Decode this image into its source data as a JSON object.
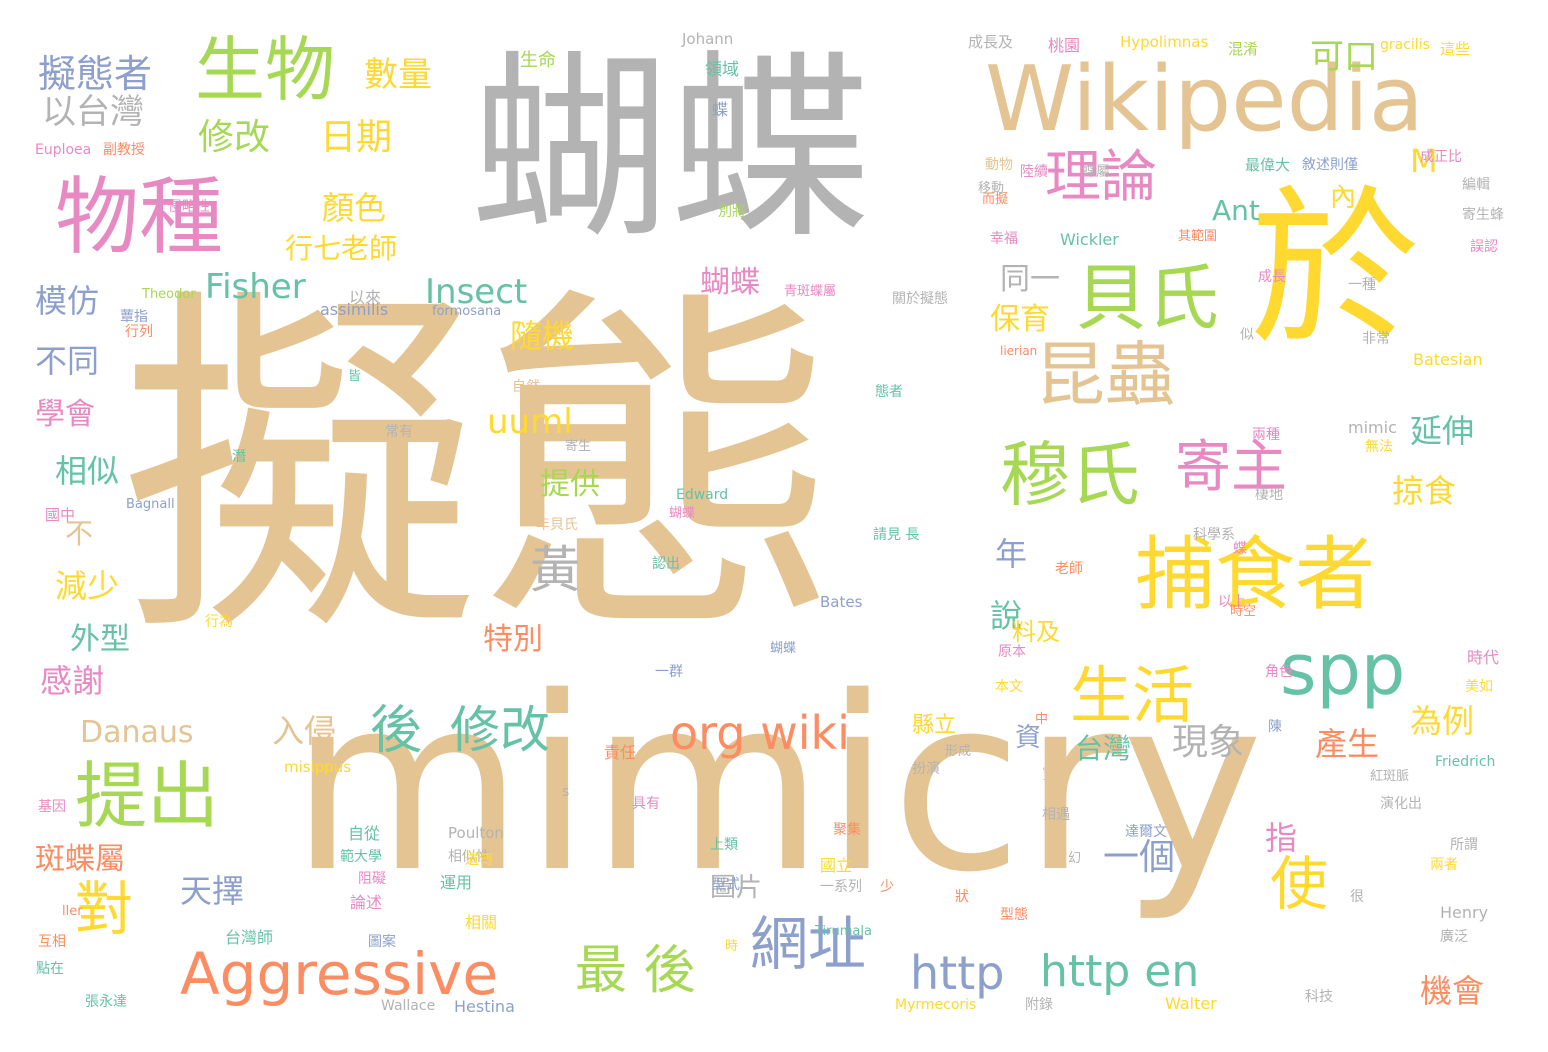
{
  "cloud": {
    "words": [
      {
        "text": "擬態",
        "color": "#e5c494"
      },
      {
        "text": "mimicry",
        "color": "#e5c494"
      },
      {
        "text": "蝴蝶",
        "color": "#b3b3b3"
      },
      {
        "text": "於",
        "color": "#ffd92f"
      },
      {
        "text": "Wikipedia",
        "color": "#e5c494"
      },
      {
        "text": "物種",
        "color": "#e78ac3"
      },
      {
        "text": "生物",
        "color": "#a6d854"
      },
      {
        "text": "捕食者",
        "color": "#ffd92f"
      },
      {
        "text": "提出",
        "color": "#a6d854"
      },
      {
        "text": "昆蟲",
        "color": "#e5c494"
      },
      {
        "text": "貝氏",
        "color": "#a6d854"
      },
      {
        "text": "穆氏",
        "color": "#a6d854"
      },
      {
        "text": "spp",
        "color": "#66c2a5"
      },
      {
        "text": "生活",
        "color": "#ffd92f"
      },
      {
        "text": "Aggressive",
        "color": "#fc8d62"
      },
      {
        "text": "對",
        "color": "#ffd92f"
      },
      {
        "text": "理論",
        "color": "#e78ac3"
      },
      {
        "text": "寄主",
        "color": "#e78ac3"
      },
      {
        "text": "修改",
        "color": "#66c2a5"
      },
      {
        "text": "org wiki",
        "color": "#fc8d62"
      },
      {
        "text": "http",
        "color": "#8da0cb"
      },
      {
        "text": "http en",
        "color": "#66c2a5"
      },
      {
        "text": "使",
        "color": "#ffd92f"
      },
      {
        "text": "網址",
        "color": "#8da0cb"
      },
      {
        "text": "最 後",
        "color": "#a6d854"
      },
      {
        "text": "黃",
        "color": "#b3b3b3"
      },
      {
        "text": "後",
        "color": "#66c2a5"
      },
      {
        "text": "擬態者",
        "color": "#8da0cb"
      },
      {
        "text": "以台灣",
        "color": "#b3b3b3"
      },
      {
        "text": "修改",
        "color": "#a6d854"
      },
      {
        "text": "日期",
        "color": "#ffd92f"
      },
      {
        "text": "數量",
        "color": "#ffd92f"
      },
      {
        "text": "可口",
        "color": "#a6d854"
      },
      {
        "text": "顏色",
        "color": "#ffd92f"
      },
      {
        "text": "行七老師",
        "color": "#ffd92f"
      },
      {
        "text": "Fisher",
        "color": "#66c2a5"
      },
      {
        "text": "Insect",
        "color": "#66c2a5"
      },
      {
        "text": "Ant",
        "color": "#66c2a5"
      },
      {
        "text": "M",
        "color": "#ffd92f"
      },
      {
        "text": "內",
        "color": "#ffd92f"
      },
      {
        "text": "同一",
        "color": "#b3b3b3"
      },
      {
        "text": "保育",
        "color": "#ffd92f"
      },
      {
        "text": "蝴蝶",
        "color": "#e78ac3"
      },
      {
        "text": "模仿",
        "color": "#8da0cb"
      },
      {
        "text": "不同",
        "color": "#8da0cb"
      },
      {
        "text": "隨機",
        "color": "#ffd92f"
      },
      {
        "text": "學會",
        "color": "#e78ac3"
      },
      {
        "text": "uuml",
        "color": "#ffd92f"
      },
      {
        "text": "相似",
        "color": "#66c2a5"
      },
      {
        "text": "延伸",
        "color": "#66c2a5"
      },
      {
        "text": "掠食",
        "color": "#ffd92f"
      },
      {
        "text": "不",
        "color": "#e5c494"
      },
      {
        "text": "提供",
        "color": "#a6d854"
      },
      {
        "text": "減少",
        "color": "#ffd92f"
      },
      {
        "text": "外型",
        "color": "#66c2a5"
      },
      {
        "text": "特別",
        "color": "#fc8d62"
      },
      {
        "text": "感謝",
        "color": "#e78ac3"
      },
      {
        "text": "入侵",
        "color": "#e5c494"
      },
      {
        "text": "Danaus",
        "color": "#e5c494"
      },
      {
        "text": "台灣",
        "color": "#66c2a5"
      },
      {
        "text": "現象",
        "color": "#b3b3b3"
      },
      {
        "text": "產生",
        "color": "#fc8d62"
      },
      {
        "text": "為例",
        "color": "#ffd92f"
      },
      {
        "text": "年",
        "color": "#8da0cb"
      },
      {
        "text": "說",
        "color": "#66c2a5"
      },
      {
        "text": "料及",
        "color": "#ffd92f"
      },
      {
        "text": "一個",
        "color": "#8da0cb"
      },
      {
        "text": "指",
        "color": "#e78ac3"
      },
      {
        "text": "斑蝶屬",
        "color": "#fc8d62"
      },
      {
        "text": "天擇",
        "color": "#8da0cb"
      },
      {
        "text": "圖片",
        "color": "#b3b3b3"
      },
      {
        "text": "機會",
        "color": "#fc8d62"
      },
      {
        "text": "資",
        "color": "#8da0cb"
      },
      {
        "text": "生命",
        "color": "#a6d854"
      },
      {
        "text": "Johann",
        "color": "#b3b3b3"
      },
      {
        "text": "成長及",
        "color": "#b3b3b3"
      },
      {
        "text": "桃園",
        "color": "#e78ac3"
      },
      {
        "text": "Hypolimnas",
        "color": "#ffd92f"
      },
      {
        "text": "混淆",
        "color": "#a6d854"
      },
      {
        "text": "gracilis",
        "color": "#ffd92f"
      },
      {
        "text": "這些",
        "color": "#ffd92f"
      },
      {
        "text": "領域",
        "color": "#66c2a5"
      },
      {
        "text": "蝶",
        "color": "#8da0cb"
      },
      {
        "text": "Euploea",
        "color": "#e78ac3"
      },
      {
        "text": "副教授",
        "color": "#fc8d62"
      },
      {
        "text": "陸續",
        "color": "#e78ac3"
      },
      {
        "text": "蝶屬",
        "color": "#b3b3b3"
      },
      {
        "text": "最偉大",
        "color": "#66c2a5"
      },
      {
        "text": "敘述則僅",
        "color": "#8da0cb"
      },
      {
        "text": "成正比",
        "color": "#e78ac3"
      },
      {
        "text": "編輯",
        "color": "#b3b3b3"
      },
      {
        "text": "寄生蜂",
        "color": "#b3b3b3"
      },
      {
        "text": "誤認",
        "color": "#e78ac3"
      },
      {
        "text": "侵略性",
        "color": "#e78ac3"
      },
      {
        "text": "而擬",
        "color": "#fc8d62"
      },
      {
        "text": "動物",
        "color": "#e5c494"
      },
      {
        "text": "移動",
        "color": "#b3b3b3"
      },
      {
        "text": "別將",
        "color": "#a6d854"
      },
      {
        "text": "幸福",
        "color": "#e78ac3"
      },
      {
        "text": "Wickler",
        "color": "#66c2a5"
      },
      {
        "text": "其範圍",
        "color": "#fc8d62"
      },
      {
        "text": "Theodor",
        "color": "#a6d854"
      },
      {
        "text": "蕈指",
        "color": "#8da0cb"
      },
      {
        "text": "以來",
        "color": "#b3b3b3"
      },
      {
        "text": "青斑蝶屬",
        "color": "#e78ac3"
      },
      {
        "text": "關於擬態",
        "color": "#b3b3b3"
      },
      {
        "text": "成長",
        "color": "#e78ac3"
      },
      {
        "text": "一種",
        "color": "#b3b3b3"
      },
      {
        "text": "行列",
        "color": "#fc8d62"
      },
      {
        "text": "assimilis",
        "color": "#8da0cb"
      },
      {
        "text": "formosana",
        "color": "#8da0cb"
      },
      {
        "text": "似",
        "color": "#b3b3b3"
      },
      {
        "text": "非常",
        "color": "#b3b3b3"
      },
      {
        "text": "lierian",
        "color": "#fc8d62"
      },
      {
        "text": "Batesian",
        "color": "#ffd92f"
      },
      {
        "text": "皆",
        "color": "#66c2a5"
      },
      {
        "text": "自然",
        "color": "#e5c494"
      },
      {
        "text": "態者",
        "color": "#66c2a5"
      },
      {
        "text": "常有",
        "color": "#b3b3b3"
      },
      {
        "text": "寄生",
        "color": "#b3b3b3"
      },
      {
        "text": "mimic",
        "color": "#b3b3b3"
      },
      {
        "text": "兩種",
        "color": "#e78ac3"
      },
      {
        "text": "無法",
        "color": "#ffd92f"
      },
      {
        "text": "潛",
        "color": "#66c2a5"
      },
      {
        "text": "Edward",
        "color": "#66c2a5"
      },
      {
        "text": "棲地",
        "color": "#b3b3b3"
      },
      {
        "text": "國中",
        "color": "#e78ac3"
      },
      {
        "text": "Bagnall",
        "color": "#8da0cb"
      },
      {
        "text": "年貝氏",
        "color": "#e5c494"
      },
      {
        "text": "科學系",
        "color": "#b3b3b3"
      },
      {
        "text": "蝴蝶",
        "color": "#e78ac3"
      },
      {
        "text": "認出",
        "color": "#66c2a5"
      },
      {
        "text": "請見 長",
        "color": "#66c2a5"
      },
      {
        "text": "蝶",
        "color": "#e78ac3"
      },
      {
        "text": "老師",
        "color": "#fc8d62"
      },
      {
        "text": "Bates",
        "color": "#8da0cb"
      },
      {
        "text": "以上",
        "color": "#e78ac3"
      },
      {
        "text": "時空",
        "color": "#fc8d62"
      },
      {
        "text": "行為",
        "color": "#ffd92f"
      },
      {
        "text": "蝴蝶",
        "color": "#8da0cb"
      },
      {
        "text": "原本",
        "color": "#e78ac3"
      },
      {
        "text": "角色",
        "color": "#e78ac3"
      },
      {
        "text": "時代",
        "color": "#e78ac3"
      },
      {
        "text": "一群",
        "color": "#8da0cb"
      },
      {
        "text": "本文",
        "color": "#ffd92f"
      },
      {
        "text": "美如",
        "color": "#ffd92f"
      },
      {
        "text": "中",
        "color": "#fc8d62"
      },
      {
        "text": "陳",
        "color": "#8da0cb"
      },
      {
        "text": "縣立",
        "color": "#ffd92f"
      },
      {
        "text": "形成",
        "color": "#b3b3b3"
      },
      {
        "text": "責任",
        "color": "#fc8d62"
      },
      {
        "text": "misippus",
        "color": "#ffd92f"
      },
      {
        "text": "扮演",
        "color": "#b3b3b3"
      },
      {
        "text": "寶斑",
        "color": "#e5c494"
      },
      {
        "text": "Friedrich",
        "color": "#66c2a5"
      },
      {
        "text": "紅斑脈",
        "color": "#b3b3b3"
      },
      {
        "text": "基因",
        "color": "#e78ac3"
      },
      {
        "text": "s",
        "color": "#b3b3b3"
      },
      {
        "text": "具有",
        "color": "#e78ac3"
      },
      {
        "text": "相遇",
        "color": "#b3b3b3"
      },
      {
        "text": "演化出",
        "color": "#b3b3b3"
      },
      {
        "text": "自從",
        "color": "#66c2a5"
      },
      {
        "text": "Poulton",
        "color": "#b3b3b3"
      },
      {
        "text": "達爾文",
        "color": "#8da0cb"
      },
      {
        "text": "幻",
        "color": "#b3b3b3"
      },
      {
        "text": "範大學",
        "color": "#66c2a5"
      },
      {
        "text": "阻礙",
        "color": "#e78ac3"
      },
      {
        "text": "相似性",
        "color": "#b3b3b3"
      },
      {
        "text": "遺傳",
        "color": "#ffd92f"
      },
      {
        "text": "上類",
        "color": "#66c2a5"
      },
      {
        "text": "聚集",
        "color": "#fc8d62"
      },
      {
        "text": "國立",
        "color": "#ffd92f"
      },
      {
        "text": "所謂",
        "color": "#b3b3b3"
      },
      {
        "text": "論述",
        "color": "#e78ac3"
      },
      {
        "text": "運用",
        "color": "#66c2a5"
      },
      {
        "text": "型式",
        "color": "#8da0cb"
      },
      {
        "text": "一系列",
        "color": "#b3b3b3"
      },
      {
        "text": "兩者",
        "color": "#ffd92f"
      },
      {
        "text": "ller",
        "color": "#fc8d62"
      },
      {
        "text": "少",
        "color": "#fc8d62"
      },
      {
        "text": "狀",
        "color": "#fc8d62"
      },
      {
        "text": "很",
        "color": "#b3b3b3"
      },
      {
        "text": "Henry",
        "color": "#b3b3b3"
      },
      {
        "text": "互相",
        "color": "#fc8d62"
      },
      {
        "text": "台灣師",
        "color": "#66c2a5"
      },
      {
        "text": "相關",
        "color": "#ffd92f"
      },
      {
        "text": "Tirumala",
        "color": "#66c2a5"
      },
      {
        "text": "型態",
        "color": "#fc8d62"
      },
      {
        "text": "廣泛",
        "color": "#b3b3b3"
      },
      {
        "text": "點在",
        "color": "#66c2a5"
      },
      {
        "text": "圖案",
        "color": "#8da0cb"
      },
      {
        "text": "時",
        "color": "#ffd92f"
      },
      {
        "text": "張永達",
        "color": "#66c2a5"
      },
      {
        "text": "Wallace",
        "color": "#b3b3b3"
      },
      {
        "text": "Hestina",
        "color": "#8da0cb"
      },
      {
        "text": "Myrmecoris",
        "color": "#ffd92f"
      },
      {
        "text": "附錄",
        "color": "#b3b3b3"
      },
      {
        "text": "Walter",
        "color": "#ffd92f"
      },
      {
        "text": "科技",
        "color": "#b3b3b3"
      }
    ]
  }
}
